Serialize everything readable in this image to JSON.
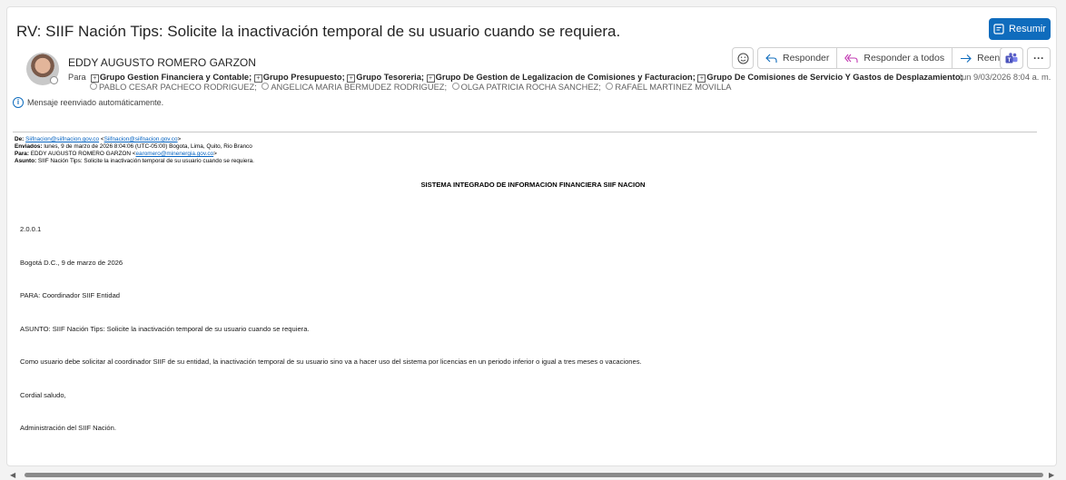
{
  "email": {
    "subject": "RV: SIIF Nación Tips: Solicite la inactivación temporal de su usuario cuando se requiera.",
    "sender_name": "EDDY AUGUSTO ROMERO GARZON",
    "to_label": "Para",
    "groups": [
      "Grupo Gestion Financiera y Contable;",
      "Grupo Presupuesto;",
      "Grupo Tesoreria;",
      "Grupo De Gestion de Legalizacion de Comisiones y Facturacion;",
      "Grupo De Comisiones de Servicio Y Gastos de Desplazamiento;"
    ],
    "people": [
      "PABLO CESAR PACHECO RODRIGUEZ;",
      "ANGELICA MARIA BERMUDEZ RODRIGUEZ;",
      "OLGA PATRICIA ROCHA SANCHEZ;",
      "RAFAEL MARTINEZ MOVILLA"
    ],
    "datetime": "lun 9/03/2026 8:04 a. m.",
    "forward_note": "Mensaje reenviado automáticamente."
  },
  "toolbar": {
    "resumir": "Resumir",
    "responder": "Responder",
    "responder_todos": "Responder a todos",
    "reenviar": "Reenviar",
    "more": "···"
  },
  "forwarded": {
    "de_label": "De:",
    "de_email1": "Siifnacion@siifnacion.gov.co",
    "de_email2": "Siifnacion@siifnacion.gov.co",
    "enviados_label": "Enviados:",
    "enviados_value": "lunes, 9 de marzo de 2026 8:04:06 (UTC-05:00) Bogota, Lima, Quito, Rio Branco",
    "para_label": "Para:",
    "para_name": "EDDY AUGUSTO ROMERO GARZON",
    "para_email": "earomero@minenergia.gov.co",
    "asunto_label": "Asunto:",
    "asunto_value": "SIIF Nación Tips: Solicite la inactivación temporal de su usuario cuando se requiera."
  },
  "body": {
    "title": "SISTEMA INTEGRADO DE INFORMACION FINANCIERA SIIF NACION",
    "code": "2.0.0.1",
    "place_date": "Bogotá D.C., 9 de marzo de 2026",
    "para": "PARA: Coordinador SIIF Entidad",
    "asunto": "ASUNTO: SIIF Nación Tips: Solicite la inactivación temporal de su usuario cuando se requiera.",
    "message": "Como usuario debe solicitar al coordinador SIIF de su entidad, la inactivación temporal de su usuario sino va a hacer uso del sistema por licencias en un periodo inferior o igual a tres meses o vacaciones.",
    "greeting": "Cordial saludo,",
    "signature": "Administración del SIIF Nación."
  },
  "colors": {
    "accent": "#0f6cbd",
    "link": "#0563c1"
  }
}
